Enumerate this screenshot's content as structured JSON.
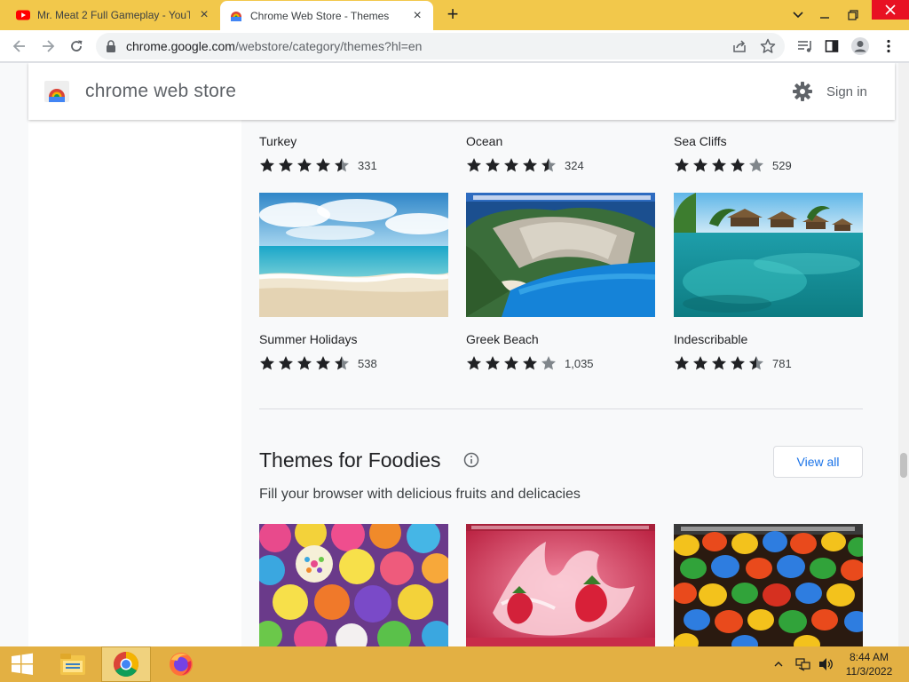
{
  "browser": {
    "tabs": [
      {
        "title": "Mr. Meat 2 Full Gameplay - YouTube",
        "favicon": "youtube-icon",
        "active": false
      },
      {
        "title": "Chrome Web Store - Themes",
        "favicon": "chrome-web-store-icon",
        "active": true
      }
    ],
    "url": {
      "host": "chrome.google.com",
      "path": "/webstore/category/themes?hl=en"
    },
    "colors": {
      "tabstrip": "#f2c84b",
      "active_tab": "#ffffff",
      "close_button": "#e81123"
    }
  },
  "store": {
    "name": "chrome web store",
    "sign_in": "Sign in",
    "link_color": "#1a73e8"
  },
  "themes_top": [
    {
      "name": "Turkey",
      "rating": 4.5,
      "count": "331"
    },
    {
      "name": "Ocean",
      "rating": 4.5,
      "count": "324"
    },
    {
      "name": "Sea Cliffs",
      "rating": 4,
      "count": "529"
    }
  ],
  "themes_mid": [
    {
      "name": "Summer Holidays",
      "rating": 4.5,
      "count": "538",
      "image": "beach-thumbnail"
    },
    {
      "name": "Greek Beach",
      "rating": 4,
      "count": "1,035",
      "image": "cliff-beach-thumbnail"
    },
    {
      "name": "Indescribable",
      "rating": 4.5,
      "count": "781",
      "image": "tropical-bungalows-thumbnail"
    }
  ],
  "foodies": {
    "title": "Themes for Foodies",
    "subtitle": "Fill your browser with delicious fruits and delicacies",
    "view_all": "View all",
    "thumbnails": [
      "cupcakes-thumbnail",
      "strawberry-splash-thumbnail",
      "candies-thumbnail"
    ]
  },
  "taskbar": {
    "apps": [
      "start-button",
      "file-explorer",
      "chrome",
      "firefox"
    ],
    "time": "8:44 AM",
    "date": "11/3/2022"
  }
}
